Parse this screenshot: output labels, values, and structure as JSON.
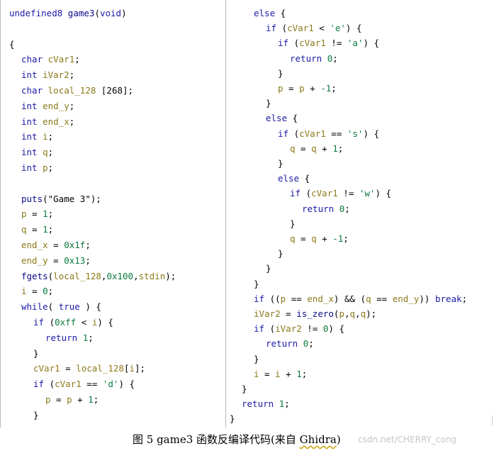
{
  "colors": {
    "keyword": "#1a1aa6",
    "variable": "#8c7a19",
    "number": "#0b7a3e",
    "function": "#0a0a8a",
    "plain": "#000000",
    "panel_border": "#b8b8b8"
  },
  "left_code": [
    {
      "indent": 0,
      "tokens": [
        {
          "t": "undefined8",
          "c": "k"
        },
        {
          "t": " "
        },
        {
          "t": "game3",
          "c": "f"
        },
        {
          "t": "("
        },
        {
          "t": "void",
          "c": "k"
        },
        {
          "t": ")"
        }
      ]
    },
    {
      "indent": 0,
      "tokens": []
    },
    {
      "indent": 0,
      "tokens": [
        {
          "t": "{"
        }
      ]
    },
    {
      "indent": 1,
      "tokens": [
        {
          "t": "char",
          "c": "k"
        },
        {
          "t": " "
        },
        {
          "t": "cVar1",
          "c": "v"
        },
        {
          "t": ";"
        }
      ]
    },
    {
      "indent": 1,
      "tokens": [
        {
          "t": "int",
          "c": "k"
        },
        {
          "t": " "
        },
        {
          "t": "iVar2",
          "c": "v"
        },
        {
          "t": ";"
        }
      ]
    },
    {
      "indent": 1,
      "tokens": [
        {
          "t": "char",
          "c": "k"
        },
        {
          "t": " "
        },
        {
          "t": "local_128",
          "c": "v"
        },
        {
          "t": " [268];"
        }
      ]
    },
    {
      "indent": 1,
      "tokens": [
        {
          "t": "int",
          "c": "k"
        },
        {
          "t": " "
        },
        {
          "t": "end_y",
          "c": "v"
        },
        {
          "t": ";"
        }
      ]
    },
    {
      "indent": 1,
      "tokens": [
        {
          "t": "int",
          "c": "k"
        },
        {
          "t": " "
        },
        {
          "t": "end_x",
          "c": "v"
        },
        {
          "t": ";"
        }
      ]
    },
    {
      "indent": 1,
      "tokens": [
        {
          "t": "int",
          "c": "k"
        },
        {
          "t": " "
        },
        {
          "t": "i",
          "c": "v"
        },
        {
          "t": ";"
        }
      ]
    },
    {
      "indent": 1,
      "tokens": [
        {
          "t": "int",
          "c": "k"
        },
        {
          "t": " "
        },
        {
          "t": "q",
          "c": "v"
        },
        {
          "t": ";"
        }
      ]
    },
    {
      "indent": 1,
      "tokens": [
        {
          "t": "int",
          "c": "k"
        },
        {
          "t": " "
        },
        {
          "t": "p",
          "c": "v"
        },
        {
          "t": ";"
        }
      ]
    },
    {
      "indent": 0,
      "tokens": []
    },
    {
      "indent": 1,
      "tokens": [
        {
          "t": "puts",
          "c": "f"
        },
        {
          "t": "(\"Game 3\");"
        }
      ]
    },
    {
      "indent": 1,
      "tokens": [
        {
          "t": "p",
          "c": "v"
        },
        {
          "t": " = "
        },
        {
          "t": "1",
          "c": "n"
        },
        {
          "t": ";"
        }
      ]
    },
    {
      "indent": 1,
      "tokens": [
        {
          "t": "q",
          "c": "v"
        },
        {
          "t": " = "
        },
        {
          "t": "1",
          "c": "n"
        },
        {
          "t": ";"
        }
      ]
    },
    {
      "indent": 1,
      "tokens": [
        {
          "t": "end_x",
          "c": "v"
        },
        {
          "t": " = "
        },
        {
          "t": "0x1f",
          "c": "n"
        },
        {
          "t": ";"
        }
      ]
    },
    {
      "indent": 1,
      "tokens": [
        {
          "t": "end_y",
          "c": "v"
        },
        {
          "t": " = "
        },
        {
          "t": "0x13",
          "c": "n"
        },
        {
          "t": ";"
        }
      ]
    },
    {
      "indent": 1,
      "tokens": [
        {
          "t": "fgets",
          "c": "f"
        },
        {
          "t": "("
        },
        {
          "t": "local_128",
          "c": "v"
        },
        {
          "t": ","
        },
        {
          "t": "0x100",
          "c": "n"
        },
        {
          "t": ","
        },
        {
          "t": "stdin",
          "c": "v"
        },
        {
          "t": ");"
        }
      ]
    },
    {
      "indent": 1,
      "tokens": [
        {
          "t": "i",
          "c": "v"
        },
        {
          "t": " = "
        },
        {
          "t": "0",
          "c": "n"
        },
        {
          "t": ";"
        }
      ]
    },
    {
      "indent": 1,
      "tokens": [
        {
          "t": "while",
          "c": "k"
        },
        {
          "t": "( "
        },
        {
          "t": "true",
          "c": "k"
        },
        {
          "t": " ) {"
        }
      ]
    },
    {
      "indent": 2,
      "tokens": [
        {
          "t": "if",
          "c": "k"
        },
        {
          "t": " ("
        },
        {
          "t": "0xff",
          "c": "n"
        },
        {
          "t": " < "
        },
        {
          "t": "i",
          "c": "v"
        },
        {
          "t": ") {"
        }
      ]
    },
    {
      "indent": 3,
      "tokens": [
        {
          "t": "return",
          "c": "k"
        },
        {
          "t": " "
        },
        {
          "t": "1",
          "c": "n"
        },
        {
          "t": ";"
        }
      ]
    },
    {
      "indent": 2,
      "tokens": [
        {
          "t": "}"
        }
      ]
    },
    {
      "indent": 2,
      "tokens": [
        {
          "t": "cVar1",
          "c": "v"
        },
        {
          "t": " = "
        },
        {
          "t": "local_128",
          "c": "v"
        },
        {
          "t": "["
        },
        {
          "t": "i",
          "c": "v"
        },
        {
          "t": "];"
        }
      ]
    },
    {
      "indent": 2,
      "tokens": [
        {
          "t": "if",
          "c": "k"
        },
        {
          "t": " ("
        },
        {
          "t": "cVar1",
          "c": "v"
        },
        {
          "t": " == "
        },
        {
          "t": "'d'",
          "c": "n"
        },
        {
          "t": ") {"
        }
      ]
    },
    {
      "indent": 3,
      "tokens": [
        {
          "t": "p",
          "c": "v"
        },
        {
          "t": " = "
        },
        {
          "t": "p",
          "c": "v"
        },
        {
          "t": " + "
        },
        {
          "t": "1",
          "c": "n"
        },
        {
          "t": ";"
        }
      ]
    },
    {
      "indent": 2,
      "tokens": [
        {
          "t": "}"
        }
      ]
    }
  ],
  "right_code": [
    {
      "indent": 2,
      "tokens": [
        {
          "t": "else",
          "c": "k"
        },
        {
          "t": " {"
        }
      ]
    },
    {
      "indent": 3,
      "tokens": [
        {
          "t": "if",
          "c": "k"
        },
        {
          "t": " ("
        },
        {
          "t": "cVar1",
          "c": "v"
        },
        {
          "t": " < "
        },
        {
          "t": "'e'",
          "c": "n"
        },
        {
          "t": ") {"
        }
      ]
    },
    {
      "indent": 4,
      "tokens": [
        {
          "t": "if",
          "c": "k"
        },
        {
          "t": " ("
        },
        {
          "t": "cVar1",
          "c": "v"
        },
        {
          "t": " != "
        },
        {
          "t": "'a'",
          "c": "n"
        },
        {
          "t": ") {"
        }
      ]
    },
    {
      "indent": 5,
      "tokens": [
        {
          "t": "return",
          "c": "k"
        },
        {
          "t": " "
        },
        {
          "t": "0",
          "c": "n"
        },
        {
          "t": ";"
        }
      ]
    },
    {
      "indent": 4,
      "tokens": [
        {
          "t": "}"
        }
      ]
    },
    {
      "indent": 4,
      "tokens": [
        {
          "t": "p",
          "c": "v"
        },
        {
          "t": " = "
        },
        {
          "t": "p",
          "c": "v"
        },
        {
          "t": " + "
        },
        {
          "t": "-1",
          "c": "n"
        },
        {
          "t": ";"
        }
      ]
    },
    {
      "indent": 3,
      "tokens": [
        {
          "t": "}"
        }
      ]
    },
    {
      "indent": 3,
      "tokens": [
        {
          "t": "else",
          "c": "k"
        },
        {
          "t": " {"
        }
      ]
    },
    {
      "indent": 4,
      "tokens": [
        {
          "t": "if",
          "c": "k"
        },
        {
          "t": " ("
        },
        {
          "t": "cVar1",
          "c": "v"
        },
        {
          "t": " == "
        },
        {
          "t": "'s'",
          "c": "n"
        },
        {
          "t": ") {"
        }
      ]
    },
    {
      "indent": 5,
      "tokens": [
        {
          "t": "q",
          "c": "v"
        },
        {
          "t": " = "
        },
        {
          "t": "q",
          "c": "v"
        },
        {
          "t": " + "
        },
        {
          "t": "1",
          "c": "n"
        },
        {
          "t": ";"
        }
      ]
    },
    {
      "indent": 4,
      "tokens": [
        {
          "t": "}"
        }
      ]
    },
    {
      "indent": 4,
      "tokens": [
        {
          "t": "else",
          "c": "k"
        },
        {
          "t": " {"
        }
      ]
    },
    {
      "indent": 5,
      "tokens": [
        {
          "t": "if",
          "c": "k"
        },
        {
          "t": " ("
        },
        {
          "t": "cVar1",
          "c": "v"
        },
        {
          "t": " != "
        },
        {
          "t": "'w'",
          "c": "n"
        },
        {
          "t": ") {"
        }
      ]
    },
    {
      "indent": 6,
      "tokens": [
        {
          "t": "return",
          "c": "k"
        },
        {
          "t": " "
        },
        {
          "t": "0",
          "c": "n"
        },
        {
          "t": ";"
        }
      ]
    },
    {
      "indent": 5,
      "tokens": [
        {
          "t": "}"
        }
      ]
    },
    {
      "indent": 5,
      "tokens": [
        {
          "t": "q",
          "c": "v"
        },
        {
          "t": " = "
        },
        {
          "t": "q",
          "c": "v"
        },
        {
          "t": " + "
        },
        {
          "t": "-1",
          "c": "n"
        },
        {
          "t": ";"
        }
      ]
    },
    {
      "indent": 4,
      "tokens": [
        {
          "t": "}"
        }
      ]
    },
    {
      "indent": 3,
      "tokens": [
        {
          "t": "}"
        }
      ]
    },
    {
      "indent": 2,
      "tokens": [
        {
          "t": "}"
        }
      ]
    },
    {
      "indent": 2,
      "tokens": [
        {
          "t": "if",
          "c": "k"
        },
        {
          "t": " (("
        },
        {
          "t": "p",
          "c": "v"
        },
        {
          "t": " == "
        },
        {
          "t": "end_x",
          "c": "v"
        },
        {
          "t": ") && ("
        },
        {
          "t": "q",
          "c": "v"
        },
        {
          "t": " == "
        },
        {
          "t": "end_y",
          "c": "v"
        },
        {
          "t": ")) "
        },
        {
          "t": "break",
          "c": "k"
        },
        {
          "t": ";"
        }
      ]
    },
    {
      "indent": 2,
      "tokens": [
        {
          "t": "iVar2",
          "c": "v"
        },
        {
          "t": " = "
        },
        {
          "t": "is_zero",
          "c": "f"
        },
        {
          "t": "("
        },
        {
          "t": "p",
          "c": "v"
        },
        {
          "t": ","
        },
        {
          "t": "q",
          "c": "v"
        },
        {
          "t": ","
        },
        {
          "t": "q",
          "c": "v"
        },
        {
          "t": ");"
        }
      ]
    },
    {
      "indent": 2,
      "tokens": [
        {
          "t": "if",
          "c": "k"
        },
        {
          "t": " ("
        },
        {
          "t": "iVar2",
          "c": "v"
        },
        {
          "t": " != "
        },
        {
          "t": "0",
          "c": "n"
        },
        {
          "t": ") {"
        }
      ]
    },
    {
      "indent": 3,
      "tokens": [
        {
          "t": "return",
          "c": "k"
        },
        {
          "t": " "
        },
        {
          "t": "0",
          "c": "n"
        },
        {
          "t": ";"
        }
      ]
    },
    {
      "indent": 2,
      "tokens": [
        {
          "t": "}"
        }
      ]
    },
    {
      "indent": 2,
      "tokens": [
        {
          "t": "i",
          "c": "v"
        },
        {
          "t": " = "
        },
        {
          "t": "i",
          "c": "v"
        },
        {
          "t": " + "
        },
        {
          "t": "1",
          "c": "n"
        },
        {
          "t": ";"
        }
      ]
    },
    {
      "indent": 1,
      "tokens": [
        {
          "t": "}"
        }
      ]
    },
    {
      "indent": 1,
      "tokens": [
        {
          "t": "return",
          "c": "k"
        },
        {
          "t": " "
        },
        {
          "t": "1",
          "c": "n"
        },
        {
          "t": ";"
        }
      ]
    },
    {
      "indent": 0,
      "tokens": [
        {
          "t": "}"
        }
      ]
    }
  ],
  "caption": {
    "prefix": "图 5 game3 函数反编译代码(来自 ",
    "tool": "Ghidra",
    "suffix": ")"
  },
  "watermark": "csdn.net/CHERRY_cong"
}
